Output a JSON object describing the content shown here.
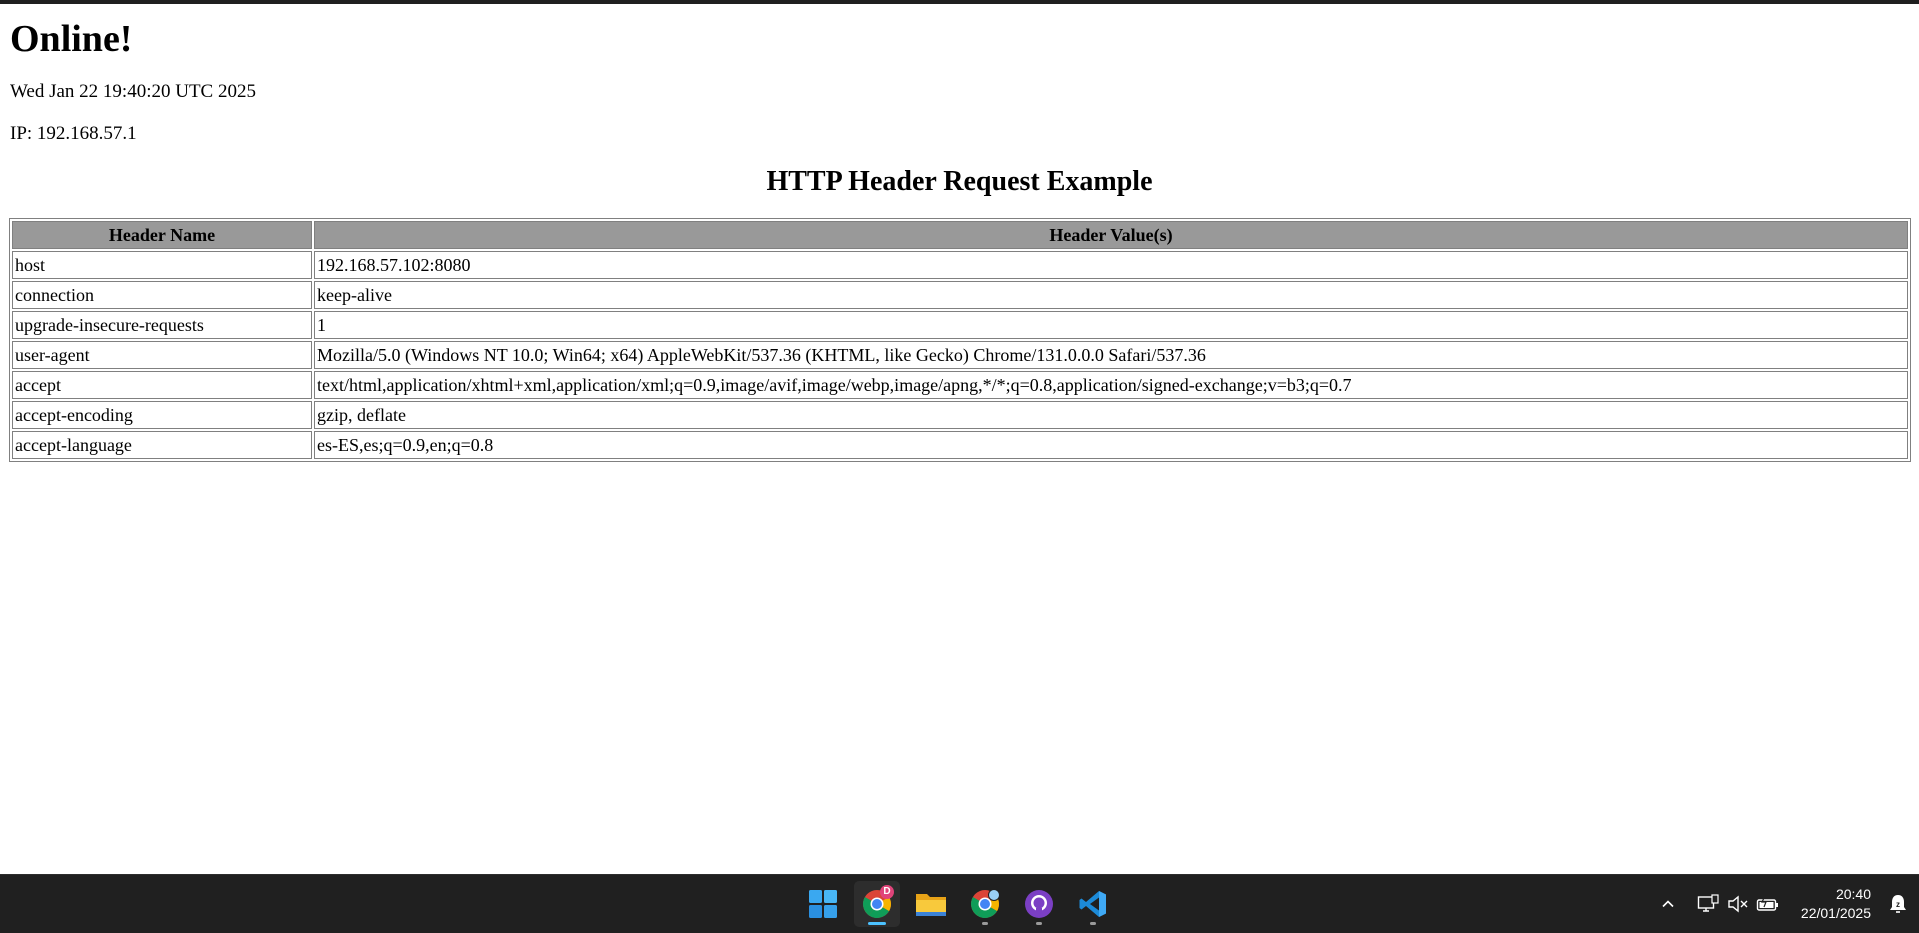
{
  "page": {
    "heading": "Online!",
    "datetime": "Wed Jan 22 19:40:20 UTC 2025",
    "ip": "IP: 192.168.57.1",
    "subheading": "HTTP Header Request Example"
  },
  "table": {
    "columns": [
      "Header Name",
      "Header Value(s)"
    ],
    "rows": [
      {
        "name": "host",
        "value": "192.168.57.102:8080"
      },
      {
        "name": "connection",
        "value": "keep-alive"
      },
      {
        "name": "upgrade-insecure-requests",
        "value": "1"
      },
      {
        "name": "user-agent",
        "value": "Mozilla/5.0 (Windows NT 10.0; Win64; x64) AppleWebKit/537.36 (KHTML, like Gecko) Chrome/131.0.0.0 Safari/537.36"
      },
      {
        "name": "accept",
        "value": "text/html,application/xhtml+xml,application/xml;q=0.9,image/avif,image/webp,image/apng,*/*;q=0.8,application/signed-exchange;v=b3;q=0.7"
      },
      {
        "name": "accept-encoding",
        "value": "gzip, deflate"
      },
      {
        "name": "accept-language",
        "value": "es-ES,es;q=0.9,en;q=0.8"
      }
    ]
  },
  "taskbar": {
    "apps": [
      {
        "icon": "windows-start-icon",
        "active": false
      },
      {
        "icon": "chrome-icon",
        "active": true,
        "badge": "D"
      },
      {
        "icon": "file-explorer-icon",
        "active": false
      },
      {
        "icon": "chrome-profile-icon",
        "active": false
      },
      {
        "icon": "github-desktop-icon",
        "active": false
      },
      {
        "icon": "vscode-icon",
        "active": false
      }
    ],
    "tray": {
      "icons": [
        "chevron-up-icon",
        "network-icon",
        "volume-muted-icon",
        "battery-icon"
      ],
      "time": "20:40",
      "date": "22/01/2025",
      "notification_icon": "notification-icon"
    }
  },
  "colors": {
    "table_header_bg": "#999999",
    "taskbar_bg": "#202020",
    "accent": "#4cc2ff"
  }
}
